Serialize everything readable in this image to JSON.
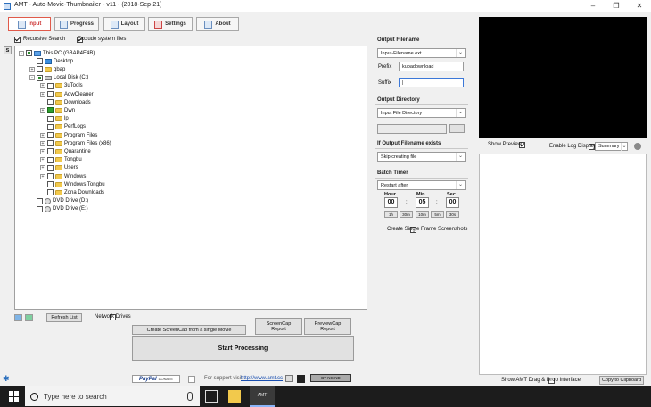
{
  "window": {
    "title": "AMT - Auto-Movie-Thumbnailer - v11 - (2018-Sep-21)",
    "controls": [
      "–",
      "❐",
      "✕"
    ]
  },
  "tabs": [
    {
      "label": "Input",
      "active": true
    },
    {
      "label": "Progress",
      "active": false
    },
    {
      "label": "Layout",
      "active": false
    },
    {
      "label": "Settings",
      "active": false
    },
    {
      "label": "About",
      "active": false
    }
  ],
  "options": {
    "recursive_search": "Recursive Search",
    "exclude_system_files": "Exclude system files",
    "s_button": "S"
  },
  "tree": [
    {
      "label": "This PC (GBAP4E4B)",
      "level": 0,
      "exp": "-",
      "check": "partial",
      "icon": "pc"
    },
    {
      "label": "Desktop",
      "level": 1,
      "exp": "",
      "check": "none",
      "icon": "desk"
    },
    {
      "label": "qbap",
      "level": 1,
      "exp": "+",
      "check": "none",
      "icon": "folder"
    },
    {
      "label": "Local Disk (C:)",
      "level": 1,
      "exp": "-",
      "check": "partial",
      "icon": "drive"
    },
    {
      "label": "3uTools",
      "level": 2,
      "exp": "+",
      "check": "none",
      "icon": "folder"
    },
    {
      "label": "AdwCleaner",
      "level": 2,
      "exp": "+",
      "check": "none",
      "icon": "folder"
    },
    {
      "label": "Downloads",
      "level": 2,
      "exp": "",
      "check": "none",
      "icon": "folder"
    },
    {
      "label": "Dwn",
      "level": 2,
      "exp": "+",
      "check": "on",
      "icon": "folder"
    },
    {
      "label": "lp",
      "level": 2,
      "exp": "",
      "check": "none",
      "icon": "folder"
    },
    {
      "label": "PerfLogs",
      "level": 2,
      "exp": "",
      "check": "none",
      "icon": "folder"
    },
    {
      "label": "Program Files",
      "level": 2,
      "exp": "+",
      "check": "none",
      "icon": "folder"
    },
    {
      "label": "Program Files (x86)",
      "level": 2,
      "exp": "+",
      "check": "none",
      "icon": "folder"
    },
    {
      "label": "Quarantine",
      "level": 2,
      "exp": "+",
      "check": "none",
      "icon": "folder"
    },
    {
      "label": "Tongbu",
      "level": 2,
      "exp": "+",
      "check": "none",
      "icon": "folder"
    },
    {
      "label": "Users",
      "level": 2,
      "exp": "+",
      "check": "none",
      "icon": "folder"
    },
    {
      "label": "Windows",
      "level": 2,
      "exp": "+",
      "check": "none",
      "icon": "folder"
    },
    {
      "label": "Windows Tongbu",
      "level": 2,
      "exp": "",
      "check": "none",
      "icon": "folder"
    },
    {
      "label": "Zona Downloads",
      "level": 2,
      "exp": "",
      "check": "none",
      "icon": "folder"
    },
    {
      "label": "DVD Drive (D:)",
      "level": 1,
      "exp": "",
      "check": "none",
      "icon": "dvd"
    },
    {
      "label": "DVD Drive (E:)",
      "level": 1,
      "exp": "",
      "check": "none",
      "icon": "dvd"
    }
  ],
  "bottom_controls": {
    "refresh_list": "Refresh List",
    "network_drives": "Network Drives",
    "create_single": "Create ScreenCap from a single Movie",
    "screencap_report": "ScreenCap Report",
    "previewcap_report": "PreviewCap Report",
    "start_processing": "Start Processing"
  },
  "output_filename": {
    "title": "Output Filename",
    "select": "Input-Filename.ext",
    "prefix_label": "Prefix",
    "prefix_value": "kubadownload",
    "suffix_label": "Suffix",
    "suffix_value": "|"
  },
  "output_directory": {
    "title": "Output Directory",
    "select": "Input File Directory",
    "browse": "..."
  },
  "if_exists": {
    "title": "If Output Filename exists",
    "select": "Skip creating file"
  },
  "batch_timer": {
    "title": "Batch Timer",
    "select": "Restart after",
    "hour_label": "Hour",
    "hour": "00",
    "min_label": "Min",
    "min": "05",
    "sec_label": "Sec",
    "sec": "00",
    "sep": ":",
    "presets": [
      "1h",
      "30m",
      "10m",
      "5m",
      "30s"
    ]
  },
  "single_frame": "Create Single Frame Screenshots",
  "preview": {
    "show_preview": "Show Preview",
    "enable_log": "Enable Log Display",
    "summary": "Summary"
  },
  "footer": {
    "paypal": "PayPal",
    "donate": "DONATE",
    "support": "For support visit:",
    "url": "http://www.amt.cc",
    "license": "BY-NC-ND",
    "drag_drop": "Show AMT Drag & Drop Interface",
    "copy_clipboard": "Copy to Clipboard"
  },
  "taskbar": {
    "search_placeholder": "Type here to search",
    "active_app": "AMT"
  }
}
